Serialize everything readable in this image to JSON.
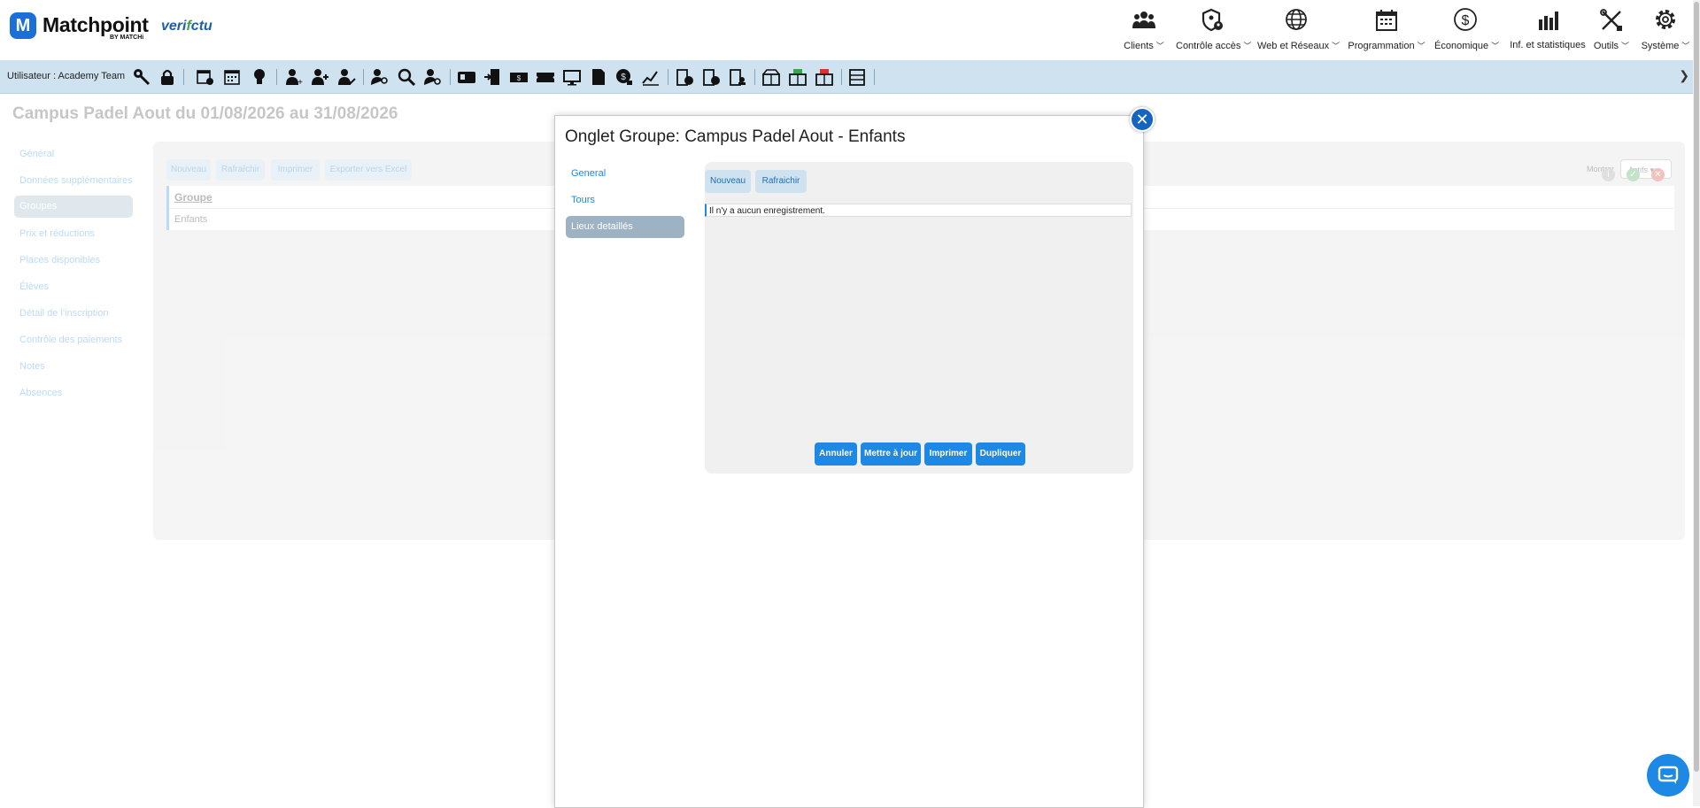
{
  "header": {
    "brand": "Matchpoint",
    "brand_sub": "BY MATCHi",
    "partner_a": "veri",
    "partner_b": "f",
    "partner_c": "ctu",
    "nav": [
      {
        "label": "Clients"
      },
      {
        "label": "Contrôle accès"
      },
      {
        "label": "Web et Réseaux"
      },
      {
        "label": "Programmation"
      },
      {
        "label": "Économique"
      },
      {
        "label": "Inf. et statistiques"
      },
      {
        "label": "Outils"
      },
      {
        "label": "Système"
      }
    ]
  },
  "toolbar": {
    "user_label": "Utilisateur :",
    "user_name": "Academy Team"
  },
  "page": {
    "title": "Campus Padel Aout du 01/08/2026 au 31/08/2026",
    "sidebar": [
      "Général",
      "Données supplémentaires",
      "Groupes",
      "Prix et réductions",
      "Places disponibles",
      "Élèves",
      "Détail de l'inscription",
      "Contrôle des paiements",
      "Notes",
      "Absences"
    ],
    "buttons": [
      "Nouveau",
      "Rafraîchir",
      "Imprimer",
      "Exporter vers Excel"
    ],
    "mostrar_label": "Montrer",
    "mostrar_value": "Actifs",
    "table_header": "Groupe",
    "table_row": "Enfants"
  },
  "modal": {
    "title": "Onglet Groupe: Campus Padel Aout - Enfants",
    "tabs": [
      "General",
      "Tours",
      "Lieux detaillés"
    ],
    "active_tab": "Lieux detaillés",
    "panel_buttons": [
      "Nouveau",
      "Rafraichir"
    ],
    "empty_message": "Il n'y a aucun enregistrement.",
    "actions": [
      "Annuler",
      "Mettre à jour",
      "Imprimer",
      "Dupliquer"
    ]
  },
  "colors": {
    "brand": "#1b6fd8",
    "toolbar_bg": "#cfe2ef",
    "accent": "#1e88e5",
    "close_button": "#1565c0"
  }
}
